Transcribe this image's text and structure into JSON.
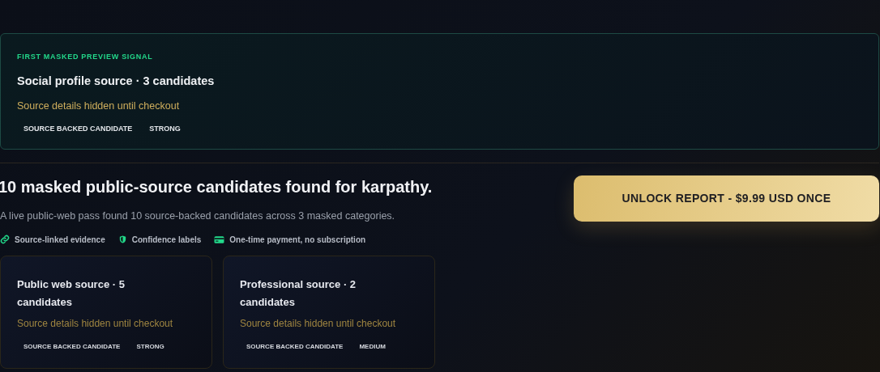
{
  "preview": {
    "eyebrow": "FIRST MASKED PREVIEW SIGNAL",
    "title": "Social profile source · 3 candidates",
    "note": "Source details hidden until checkout",
    "tags": [
      "SOURCE BACKED CANDIDATE",
      "STRONG"
    ]
  },
  "summary": {
    "heading": "10 masked public-source candidates found for karpathy.",
    "subtitle": "A live public-web pass found 10 source-backed candidates across 3 masked categories.",
    "features": [
      {
        "kind": "link",
        "label": "Source-linked evidence"
      },
      {
        "kind": "shield",
        "label": "Confidence labels"
      },
      {
        "kind": "card",
        "label": "One-time payment, no subscription"
      }
    ]
  },
  "unlock_button": "UNLOCK REPORT - $9.99 USD ONCE",
  "masked_cards": [
    {
      "title": "Public web source · 5 candidates",
      "note": "Source details hidden until checkout",
      "tags": [
        "SOURCE BACKED CANDIDATE",
        "STRONG"
      ]
    },
    {
      "title": "Professional source · 2 candidates",
      "note": "Source details hidden until checkout",
      "tags": [
        "SOURCE BACKED CANDIDATE",
        "MEDIUM"
      ]
    }
  ]
}
